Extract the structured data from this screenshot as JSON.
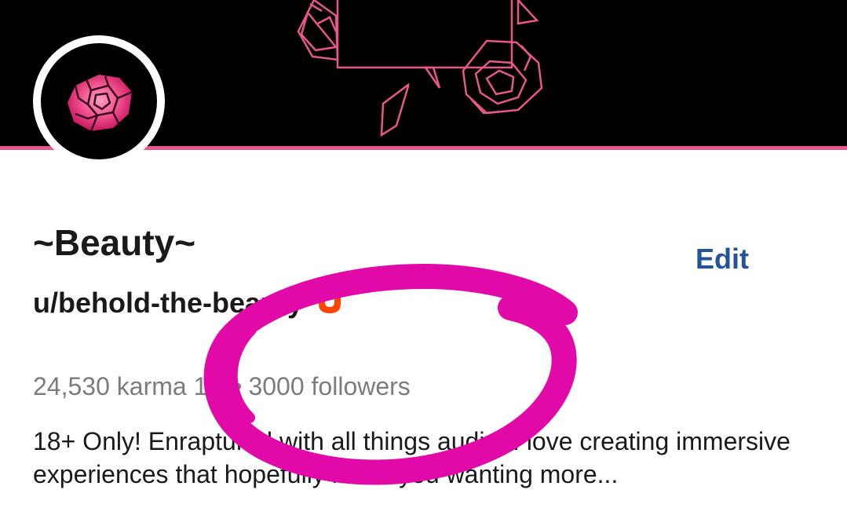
{
  "profile": {
    "display_name": "~Beauty~",
    "username": "u/behold-the-beauty",
    "edit_label": "Edit",
    "karma": "24,530 karma",
    "age": "1y",
    "separator": "•",
    "followers": "3000 followers",
    "bio": "18+ Only! Enraptured with all things audio, I love creating immersive experiences that hopefully leave you wanting more...",
    "avatar_icon": "rose-icon",
    "badge_icon": "premium-shield-icon"
  },
  "colors": {
    "banner_bg": "#000000",
    "banner_line": "#e8578c",
    "accent_link": "#24529b",
    "badge": "#ff4500",
    "markup_ink": "#e10aa8",
    "muted_text": "#7c7c7c"
  }
}
